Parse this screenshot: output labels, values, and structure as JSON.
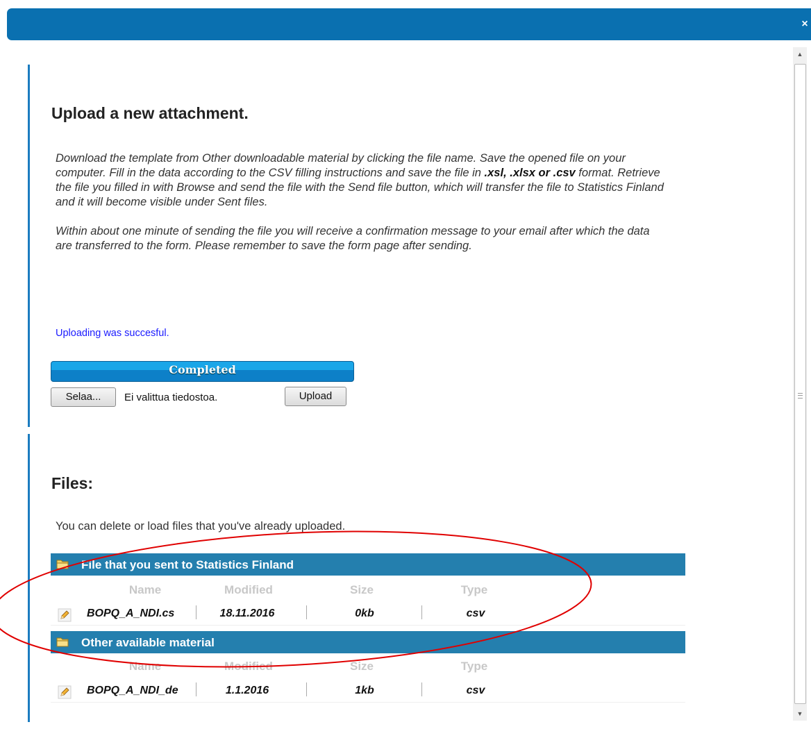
{
  "dialog": {
    "close_glyph": "×"
  },
  "upload": {
    "heading": "Upload a new attachment.",
    "instructions_1_a": "Download the template from Other downloadable material by clicking the file name. Save the opened file on your computer. Fill in the data according to the CSV filling instructions and save the file in ",
    "instructions_1_formats": ".xsl, .xlsx or .csv",
    "instructions_1_b": " format. Retrieve the file you filled in with Browse and send the file with the Send file button, which will transfer the file to Statistics Finland and it will become visible under Sent files.",
    "instructions_2": "Within about one minute of sending the file you will receive a confirmation message to your email after which the data are transferred to the form. Please remember to save the form page after sending.",
    "status_message": "Uploading was succesful.",
    "progress_label": "Completed",
    "progress_value": 1.0,
    "browse_button": "Selaa...",
    "no_file_text": "Ei valittua tiedostoa.",
    "upload_button": "Upload"
  },
  "files": {
    "heading": "Files:",
    "description": "You can delete or load files that you've already uploaded.",
    "columns": [
      "Name",
      "Modified",
      "Size",
      "Type"
    ],
    "sections": [
      {
        "title": "File that you sent to Statistics Finland",
        "rows": [
          {
            "name": "BOPQ_A_NDI.cs",
            "modified": "18.11.2016",
            "size": "0kb",
            "type": "csv"
          }
        ]
      },
      {
        "title": "Other available material",
        "rows": [
          {
            "name": "BOPQ_A_NDI_de",
            "modified": "1.1.2016",
            "size": "1kb",
            "type": "csv"
          }
        ]
      }
    ]
  },
  "colors": {
    "titlebar": "#0a70b0",
    "section_header": "#247fae",
    "status_text": "#1a1aff",
    "annotation_ellipse": "#e00000"
  }
}
